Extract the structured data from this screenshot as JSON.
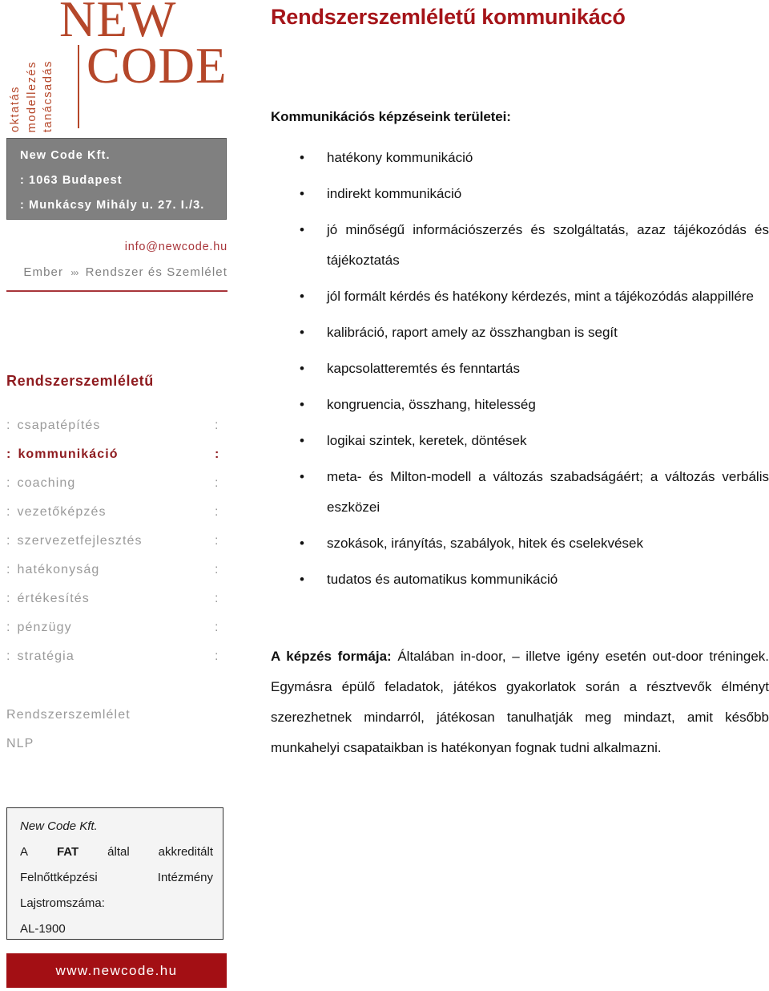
{
  "colors": {
    "logo_red": "#B5472A",
    "title_red": "#A51419",
    "nav_active_red": "#8E1B1F",
    "accent_bar_red": "#A30F14",
    "address_gray": "#808080",
    "muted_gray": "#9a9a9a"
  },
  "sidebar": {
    "logo": {
      "vertical_words": [
        "oktatás",
        "modellezés",
        "tanácsadás"
      ],
      "word_top": "NEW",
      "word_bottom": "CODE"
    },
    "address_box": {
      "lines": [
        "New Code Kft.",
        ": 1063 Budapest",
        ": Munkácsy Mihály u. 27. I./3."
      ]
    },
    "email": "info@newcode.hu",
    "slogan": {
      "before": "Ember",
      "chevrons": "›››",
      "after": "Rendszer és Szemlélet"
    },
    "nav_title": "Rendszerszemléletű",
    "nav_items": [
      {
        "label": "csapatépítés",
        "active": false
      },
      {
        "label": "kommunikáció",
        "active": true
      },
      {
        "label": "coaching",
        "active": false
      },
      {
        "label": "vezetőképzés",
        "active": false
      },
      {
        "label": "szervezetfejlesztés",
        "active": false
      },
      {
        "label": "hatékonyság",
        "active": false
      },
      {
        "label": "értékesítés",
        "active": false
      },
      {
        "label": "pénzügy",
        "active": false
      },
      {
        "label": "stratégia",
        "active": false
      }
    ],
    "nav_colon": ":",
    "nav_extra": [
      "Rendszerszemlélet",
      "NLP"
    ],
    "fat_box": {
      "company": "New Code Kft.",
      "line2_a": "A",
      "line2_b": "FAT",
      "line2_c": "által",
      "line2_d": "akkreditált",
      "line3_a": "Felnőttképzési",
      "line3_b": "Intézmény",
      "line4": "Lajstromszáma:",
      "line5": "AL-1900"
    },
    "website": "www.newcode.hu"
  },
  "main": {
    "title": "Rendszerszemléletű kommunikácó",
    "areas_heading": "Kommunikációs képzéseink területei:",
    "bullets": [
      "hatékony kommunikáció",
      "indirekt kommunikáció",
      "jó minőségű információszerzés és szolgáltatás, azaz tájékozódás és tájékoztatás",
      "jól formált kérdés és hatékony kérdezés, mint a tájékozódás alappillére",
      "kalibráció, raport amely az összhangban is segít",
      "kapcsolatteremtés és fenntartás",
      "kongruencia, összhang, hitelesség",
      "logikai szintek, keretek, döntések",
      "meta- és Milton-modell a változás szabadságáért; a változás verbális eszközei",
      "szokások, irányítás, szabályok, hitek és cselekvések",
      "tudatos és automatikus kommunikáció"
    ],
    "closing_lead": "A képzés formája:",
    "closing_body": " Általában in-door, – illetve igény esetén out-door tréningek. Egymásra épülő feladatok, játékos gyakorlatok során a résztvevők élményt szerezhetnek mindarról, játékosan tanulhatják meg mindazt, amit később munkahelyi csapataikban is hatékonyan fognak tudni alkalmazni."
  }
}
